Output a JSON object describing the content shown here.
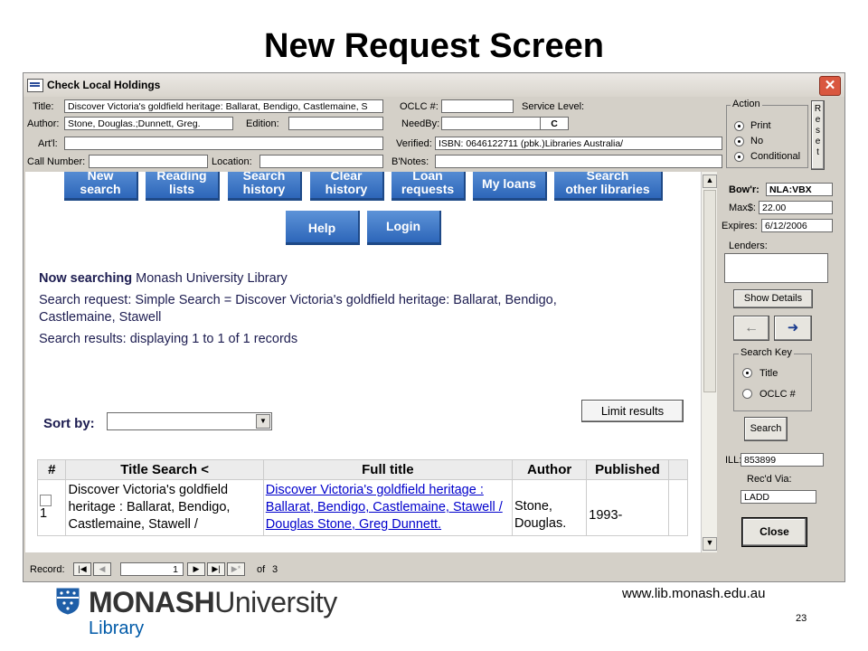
{
  "slide": {
    "title": "New Request Screen",
    "url": "www.lib.monash.edu.au",
    "page_number": "23",
    "logo_main_bold": "MONASH",
    "logo_main_light": "University",
    "logo_sub": "Library"
  },
  "window": {
    "title": "Check Local Holdings",
    "close_glyph": "✕"
  },
  "form": {
    "title_label": "Title:",
    "title_value": "Discover Victoria's goldfield heritage: Ballarat, Bendigo, Castlemaine, S",
    "author_label": "Author:",
    "author_value": "Stone, Douglas.;Dunnett, Greg.",
    "edition_label": "Edition:",
    "edition_value": "",
    "artl_label": "Art'l:",
    "artl_value": "",
    "callnumber_label": "Call Number:",
    "callnumber_value": "",
    "location_label": "Location:",
    "location_value": "",
    "oclc_label": "OCLC #:",
    "oclc_value": "",
    "service_level_label": "Service Level:",
    "service_level_value": "C",
    "needby_label": "NeedBy:",
    "needby_value": "",
    "verified_label": "Verified:",
    "verified_value": "ISBN: 0646122711 (pbk.)Libraries Australia/",
    "bnotes_label": "B'Notes:",
    "bnotes_value": ""
  },
  "action": {
    "label": "Action",
    "options": [
      "Print",
      "No",
      "Conditional"
    ],
    "reset_letters": [
      "R",
      "e",
      "s",
      "e",
      "t"
    ]
  },
  "sidepanel": {
    "borrower_label": "Bow'r:",
    "borrower_value": "NLA:VBX",
    "max_label": "Max$:",
    "max_value": "22.00",
    "expires_label": "Expires:",
    "expires_value": "6/12/2006",
    "lenders_label": "Lenders:",
    "lenders_value": "",
    "show_details": "Show Details",
    "arrow_left": "←",
    "arrow_right": "➜",
    "search_key_label": "Search Key",
    "search_key_options": [
      "Title",
      "OCLC #"
    ],
    "search_button": "Search",
    "ill_label": "ILL:",
    "ill_value": "853899",
    "recd_via_label": "Rec'd Via:",
    "recd_via_value": "LADD",
    "close_button": "Close"
  },
  "browser": {
    "nav_buttons": [
      {
        "line1": "New",
        "line2": "search"
      },
      {
        "line1": "Reading",
        "line2": "lists"
      },
      {
        "line1": "Search",
        "line2": "history"
      },
      {
        "line1": "Clear",
        "line2": "history"
      },
      {
        "line1": "Loan",
        "line2": "requests"
      },
      {
        "line1": "My loans",
        "line2": ""
      },
      {
        "line1": "Search",
        "line2": "other libraries"
      }
    ],
    "help_button": "Help",
    "login_button": "Login",
    "now_searching_bold": "Now searching",
    "now_searching_library": " Monash University Library",
    "search_request_line1": "Search request: Simple Search = Discover Victoria's goldfield heritage: Ballarat, Bendigo,",
    "search_request_line2": "Castlemaine, Stawell",
    "search_results": "Search results: displaying 1 to 1 of 1 records",
    "limit_results": "Limit results",
    "sort_by_label": "Sort by:",
    "sort_by_value": "",
    "table": {
      "headers": [
        "#",
        "Title Search <",
        "Full title",
        "Author",
        "Published"
      ],
      "rows": [
        {
          "num": "1",
          "title": "Discover Victoria's goldfield heritage : Ballarat, Bendigo, Castlemaine, Stawell /",
          "full_title": "Discover Victoria's goldfield heritage : Ballarat, Bendigo, Castlemaine, Stawell / Douglas Stone, Greg Dunnett.",
          "author": "Stone, Douglas.",
          "published": "1993-"
        }
      ]
    }
  },
  "record_nav": {
    "label": "Record:",
    "current": "1",
    "of_label": "of",
    "total": "3"
  },
  "colors": {
    "nav_button": "#2d66b9",
    "window_bg": "#d4d0c8",
    "link": "#0000cc",
    "logo_blue": "#005aa8"
  }
}
